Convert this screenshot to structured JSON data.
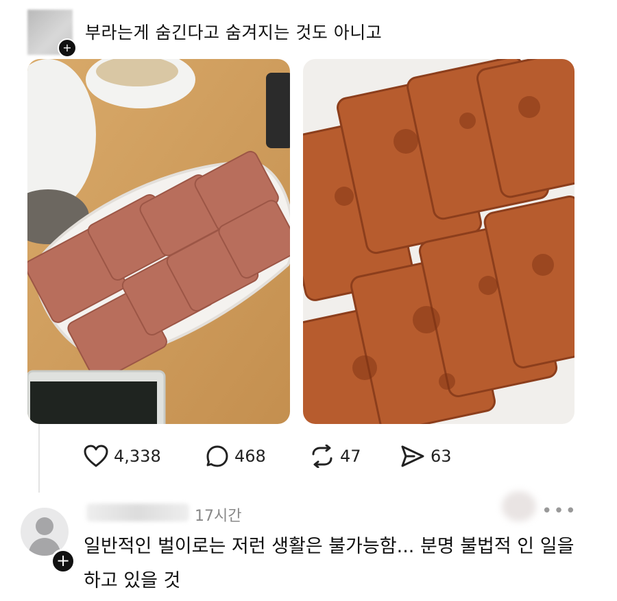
{
  "post": {
    "text": "부라는게 숨긴다고 숨겨지는 것도 아니고",
    "follow_symbol": "+"
  },
  "actions": {
    "likes": "4,338",
    "comments": "468",
    "reposts": "47",
    "shares": "63"
  },
  "reply": {
    "time": "17시간",
    "more_symbol": "•••",
    "follow_symbol": "+",
    "text": "일반적인 벌이로는 저런 생활은 불가능함... 분명 불법적 인 일을 하고 있을 것"
  },
  "icons": [
    "heart-icon",
    "comment-icon",
    "repost-icon",
    "share-icon",
    "more-icon"
  ],
  "colors": {
    "accent": "#111111",
    "muted": "#888888"
  }
}
